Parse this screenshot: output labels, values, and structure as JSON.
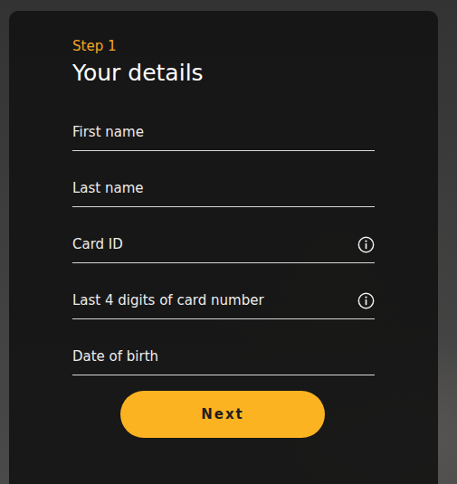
{
  "form": {
    "step": "Step 1",
    "title": "Your details",
    "fields": [
      {
        "label": "First name",
        "has_info": false
      },
      {
        "label": "Last name",
        "has_info": false
      },
      {
        "label": "Card ID",
        "has_info": true
      },
      {
        "label": "Last 4 digits of card number",
        "has_info": true
      },
      {
        "label": "Date of birth",
        "has_info": false
      }
    ],
    "button": "Next"
  }
}
